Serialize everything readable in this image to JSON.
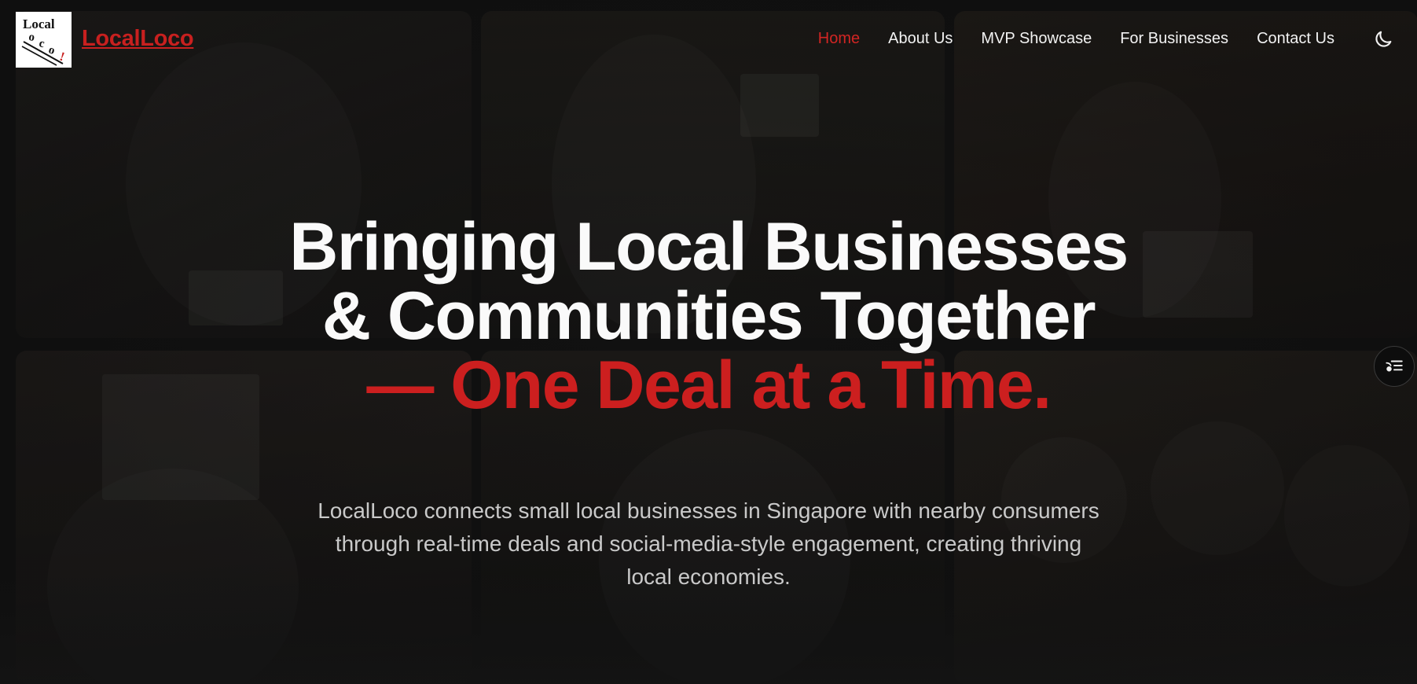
{
  "brand": {
    "name": "LocalLoco",
    "logo_text": "LocalLoco!"
  },
  "nav": {
    "items": [
      {
        "label": "Home",
        "active": true
      },
      {
        "label": "About Us",
        "active": false
      },
      {
        "label": "MVP Showcase",
        "active": false
      },
      {
        "label": "For Businesses",
        "active": false
      },
      {
        "label": "Contact Us",
        "active": false
      }
    ],
    "theme_toggle_icon": "moon-icon"
  },
  "hero": {
    "line1": "Bringing Local Businesses",
    "line2": "& Communities Together",
    "line3": "— One Deal at a Time.",
    "subtitle": "LocalLoco connects small local businesses in Singapore with nearby consumers through real-time deals and social-media-style engagement, creating thriving local economies."
  },
  "side_button": {
    "icon": "list-settings-icon"
  },
  "colors": {
    "accent": "#cc1f1f",
    "background": "#141414",
    "text": "#fafafa",
    "muted_text": "#c9c9c9"
  }
}
